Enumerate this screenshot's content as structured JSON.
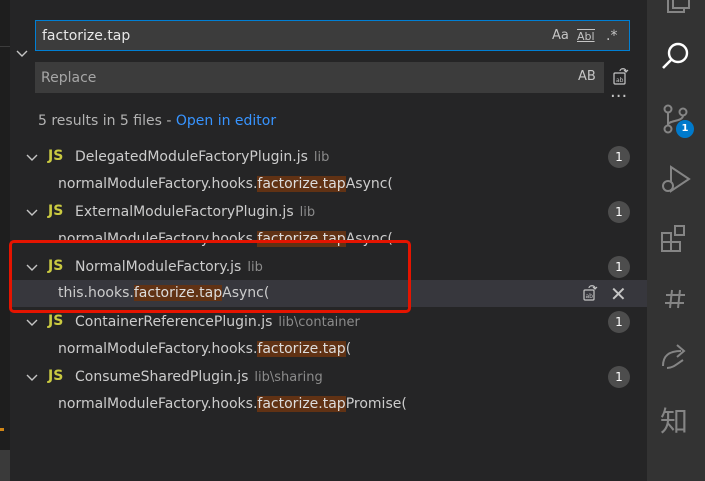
{
  "search": {
    "value": "factorize.tap",
    "opt_case": "Aa",
    "opt_word": "Abl",
    "opt_regex": ".*"
  },
  "replace": {
    "placeholder": "Replace",
    "preserve_case": "AB"
  },
  "summary": {
    "text": "5 results in 5 files - ",
    "link": "Open in editor"
  },
  "files": [
    {
      "name": "DelegatedModuleFactoryPlugin.js",
      "dir": "lib",
      "count": "1",
      "match": {
        "before": "normalModuleFactory.hooks.",
        "hit": "factorize.tap",
        "after": "Async("
      }
    },
    {
      "name": "ExternalModuleFactoryPlugin.js",
      "dir": "lib",
      "count": "1",
      "match": {
        "before": "normalModuleFactory.hooks.",
        "hit": "factorize.tap",
        "after": "Async("
      }
    },
    {
      "name": "NormalModuleFactory.js",
      "dir": "lib",
      "count": "1",
      "match": {
        "before": "this.hooks.",
        "hit": "factorize.tap",
        "after": "Async("
      }
    },
    {
      "name": "ContainerReferencePlugin.js",
      "dir": "lib\\container",
      "count": "1",
      "match": {
        "before": "normalModuleFactory.hooks.",
        "hit": "factorize.tap",
        "after": "("
      }
    },
    {
      "name": "ConsumeSharedPlugin.js",
      "dir": "lib\\sharing",
      "count": "1",
      "match": {
        "before": "normalModuleFactory.hooks.",
        "hit": "factorize.tap",
        "after": "Promise("
      }
    }
  ],
  "file_icon": "JS",
  "activity": {
    "scm_badge": "1",
    "zhi_label": "知"
  },
  "colors": {
    "accent": "#007acc",
    "match_highlight": "#613214",
    "annotation": "#e51400",
    "js": "#cbcb41"
  }
}
